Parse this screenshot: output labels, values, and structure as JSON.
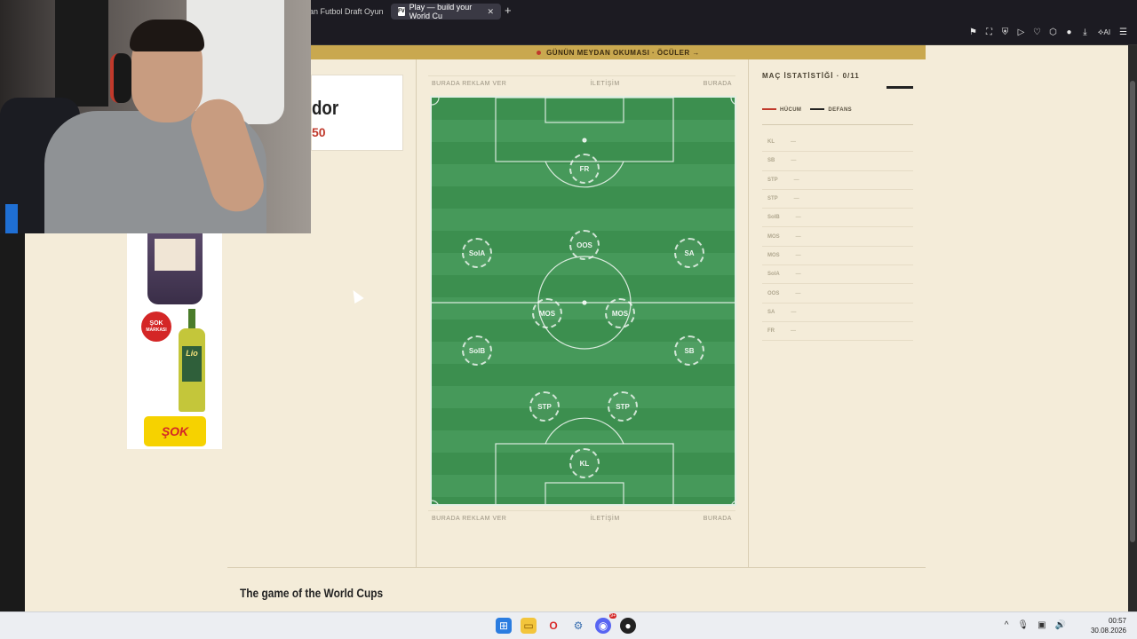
{
  "browser": {
    "tabs": [
      {
        "label": "an Futbol Draft Oyun",
        "active": false
      },
      {
        "label": "Play — build your World Cu",
        "active": true,
        "favicon": "FV"
      }
    ],
    "new_tab": "+",
    "toolbar_icons": [
      "bookmark-icon",
      "screenshot-icon",
      "shield-icon",
      "play-icon",
      "heart-icon",
      "extensions-icon",
      "profile-icon",
      "download-icon",
      "ai-icon",
      "menu-icon"
    ],
    "ai_label": "AI"
  },
  "page": {
    "banner": "GÜNÜN MEYDAN OKUMASI · ÖCÜLER →",
    "profile": {
      "name": "dor",
      "score": "50"
    },
    "ads_top": [
      "BURADA REKLAM VER",
      "İLETİŞİM",
      "BURADA"
    ],
    "ads_bottom": [
      "BURADA REKLAM VER",
      "İLETİŞİM",
      "BURADA"
    ],
    "pitch_positions": [
      {
        "label": "FR"
      },
      {
        "label": "OOS"
      },
      {
        "label": "SolA"
      },
      {
        "label": "SA"
      },
      {
        "label": "MOS"
      },
      {
        "label": "MOS"
      },
      {
        "label": "SolB"
      },
      {
        "label": "SB"
      },
      {
        "label": "STP"
      },
      {
        "label": "STP"
      },
      {
        "label": "KL"
      }
    ],
    "stats": {
      "title": "MAÇ İSTATİSTİĞİ · 0/11",
      "legend": [
        {
          "label": "HÜCUM",
          "color": "#c0392b"
        },
        {
          "label": "DEFANS",
          "color": "#222222"
        }
      ],
      "rows": [
        "KL",
        "SB",
        "STP",
        "STP",
        "SolB",
        "MOS",
        "MOS",
        "SolA",
        "OOS",
        "SA",
        "FR"
      ],
      "empty_value": "—"
    },
    "footer_title": "The game of the World Cups",
    "ad": {
      "badge_line1": "ŞOK",
      "badge_line2": "MARKASI",
      "product": "Lio",
      "logo": "ŞOK"
    }
  },
  "taskbar": {
    "time": "00:57",
    "date": "30.08.2026",
    "notification_badge": "9+"
  },
  "colors": {
    "page_bg": "#f4ecd9",
    "banner": "#c9a84f",
    "pitch": "#3c8f4f",
    "accent_red": "#c0392b"
  }
}
